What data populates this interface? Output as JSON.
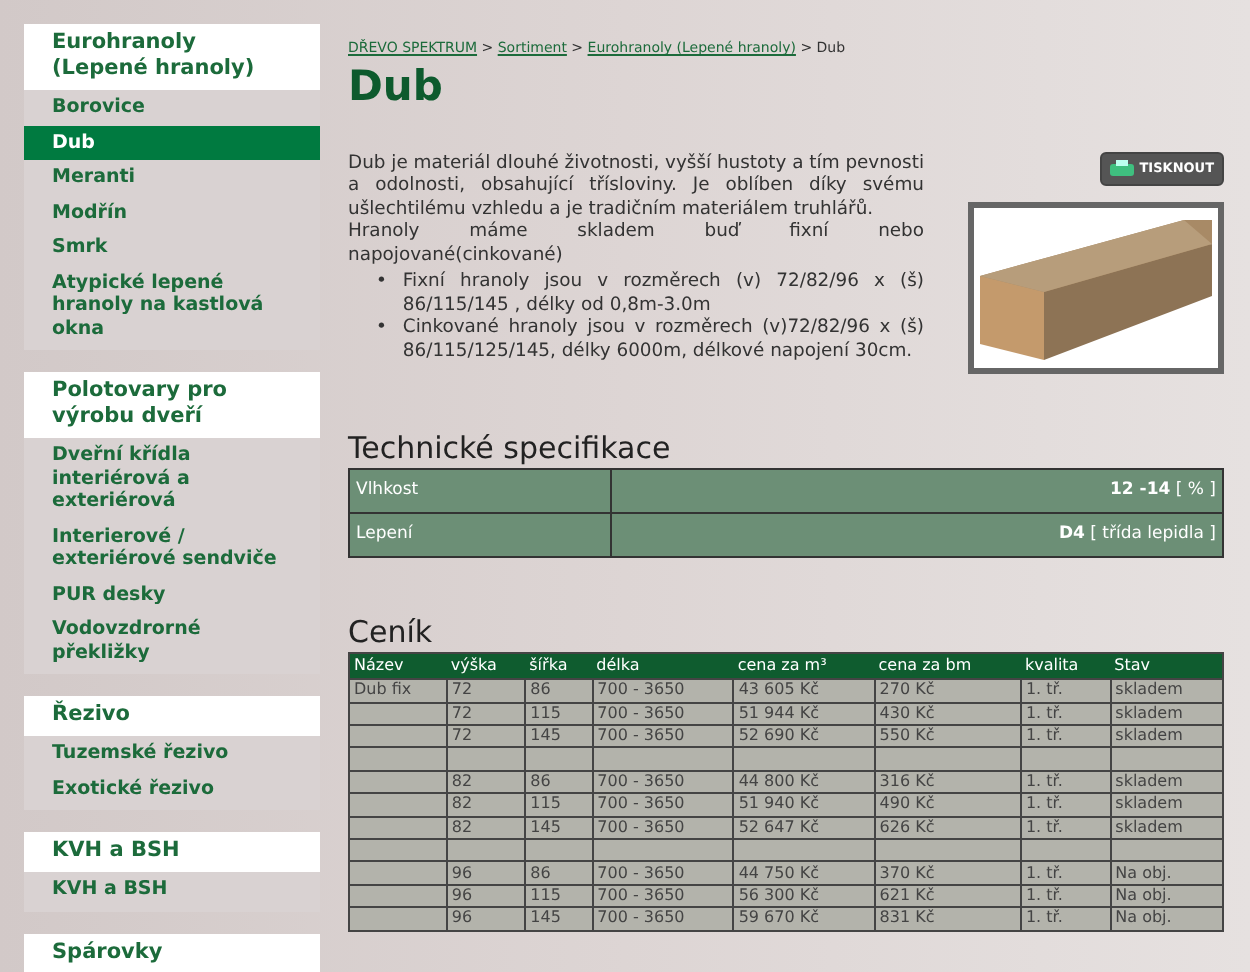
{
  "sidebar": [
    {
      "heading": "Eurohranoly (Lepené hranoly)",
      "items": [
        {
          "label": "Borovice",
          "selected": false
        },
        {
          "label": "Dub",
          "selected": true
        },
        {
          "label": "Meranti",
          "selected": false
        },
        {
          "label": "Modřín",
          "selected": false
        },
        {
          "label": "Smrk",
          "selected": false
        },
        {
          "label": "Atypické lepené hranoly na kastlová okna",
          "selected": false
        }
      ]
    },
    {
      "heading": "Polotovary pro výrobu dveří",
      "items": [
        {
          "label": "Dveřní křídla interiérová a exteriérová",
          "selected": false
        },
        {
          "label": "Interierové / exteriérové sendviče",
          "selected": false
        },
        {
          "label": "PUR desky",
          "selected": false
        },
        {
          "label": "Vodovzdrorné překližky",
          "selected": false
        }
      ]
    },
    {
      "heading": "Řezivo",
      "items": [
        {
          "label": "Tuzemské řezivo",
          "selected": false
        },
        {
          "label": "Exotické řezivo",
          "selected": false
        }
      ]
    },
    {
      "heading": "KVH a BSH",
      "items": [
        {
          "label": "KVH a BSH",
          "selected": false
        }
      ]
    },
    {
      "heading": "Spárovky"
    }
  ],
  "breadcrumb": [
    {
      "label": "DŘEVO SPEKTRUM",
      "link": true
    },
    {
      "label": "Sortiment",
      "link": true
    },
    {
      "label": "Eurohranoly (Lepené hranoly)",
      "link": true
    },
    {
      "label": "Dub",
      "link": false
    }
  ],
  "breadcrumb_separator": ">",
  "title": "Dub",
  "print_button": "TISKNOUT",
  "paragraphs": [
    "Dub je materiál dlouhé životnosti, vyšší hustoty a tím pevnosti a odolnosti, obsahující třísloviny. Je oblíben díky svému ušlechtilému vzhledu a je tradičním materiálem truhlářů.",
    "Hranoly máme skladem buď fixní nebo napojované(cinkované)"
  ],
  "bullet_marker": "•",
  "bullets": [
    "Fixní hranoly jsou v rozměrech (v) 72/82/96 x (š) 86/115/145 , délky od 0,8m-3.0m",
    "Cinkované hranoly jsou v rozměrech (v)72/82/96 x (š) 86/115/125/145, délky 6000m, délkové napojení 30cm."
  ],
  "specs_title": "Technické specifikace",
  "specs": [
    {
      "label": "Vlhkost",
      "value": "12 -14",
      "unit": "[ % ]"
    },
    {
      "label": "Lepení",
      "value": "D4",
      "unit": "[ třída lepidla ]"
    }
  ],
  "price_title": "Ceník",
  "price_table": {
    "columns": [
      "Název",
      "výška",
      "šířka",
      "délka",
      "cena za m³",
      "cena za bm",
      "kvalita",
      "Stav"
    ],
    "rows": [
      {
        "kind": "data",
        "cells": [
          "Dub fix",
          "72",
          "86",
          "700 - 3650",
          "43 605 Kč",
          "270 Kč",
          "1. tř.",
          "skladem"
        ]
      },
      {
        "kind": "data",
        "cells": [
          "",
          "72",
          "115",
          "700 - 3650",
          "51 944 Kč",
          "430 Kč",
          "1. tř.",
          "skladem"
        ]
      },
      {
        "kind": "data",
        "cells": [
          "",
          "72",
          "145",
          "700 - 3650",
          "52 690 Kč",
          "550 Kč",
          "1. tř.",
          "skladem"
        ]
      },
      {
        "kind": "spacer"
      },
      {
        "kind": "data",
        "cells": [
          "",
          "82",
          "86",
          "700 - 3650",
          "44 800 Kč",
          "316 Kč",
          "1. tř.",
          "skladem"
        ]
      },
      {
        "kind": "data",
        "cells": [
          "",
          "82",
          "115",
          "700 - 3650",
          "51 940 Kč",
          "490 Kč",
          "1. tř.",
          "skladem"
        ]
      },
      {
        "kind": "data",
        "cells": [
          "",
          "82",
          "145",
          "700 - 3650",
          "52 647 Kč",
          "626 Kč",
          "1. tř.",
          "skladem"
        ]
      },
      {
        "kind": "spacer"
      },
      {
        "kind": "data",
        "cells": [
          "",
          "96",
          "86",
          "700 - 3650",
          "44 750 Kč",
          "370 Kč",
          "1. tř.",
          "Na obj."
        ]
      },
      {
        "kind": "data",
        "cells": [
          "",
          "96",
          "115",
          "700 - 3650",
          "56 300 Kč",
          "621 Kč",
          "1. tř.",
          "Na obj."
        ]
      },
      {
        "kind": "data",
        "cells": [
          "",
          "96",
          "145",
          "700 - 3650",
          "59 670 Kč",
          "831 Kč",
          "1. tř.",
          "Na obj."
        ]
      }
    ]
  }
}
